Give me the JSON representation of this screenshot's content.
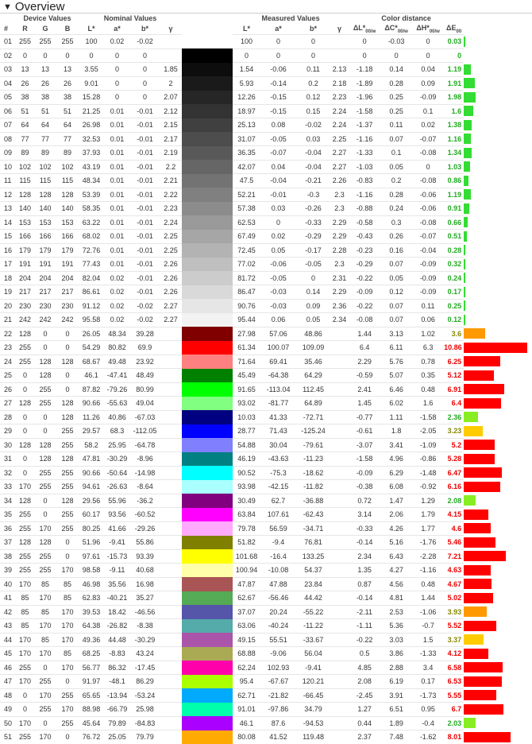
{
  "title": "Overview",
  "groups": {
    "device": "Device Values",
    "nominal": "Nominal Values",
    "measured": "Measured Values",
    "color_distance": "Color distance"
  },
  "headers": {
    "num": "#",
    "r": "R",
    "g": "G",
    "b": "B",
    "nl": "L*",
    "na": "a*",
    "nb": "b*",
    "ng": "γ",
    "ml": "L*",
    "ma": "a*",
    "mb": "b*",
    "mg": "γ",
    "dl": "ΔL*",
    "dc": "ΔC*",
    "dh": "ΔH*",
    "de": "ΔE",
    "sub_w": "00/w",
    "sub_00": "00"
  },
  "colors": {
    "good": "#33dd33",
    "ok": "#88ee22",
    "warn": "#ffcc00",
    "medium": "#ff9900",
    "bad": "#ff0000",
    "good_text": "#22aa22",
    "warn_text": "#888800",
    "bad_text": "#ee0000"
  },
  "rows": [
    {
      "n": "01",
      "r": "255",
      "g": "255",
      "b": "255",
      "nl": "100",
      "na": "0.02",
      "nb": "-0.02",
      "ng": "",
      "hex": "#ffffff",
      "ml": "100",
      "ma": "0",
      "mb": "0",
      "mg": "",
      "dl": "0",
      "dc": "-0.03",
      "dh": "0",
      "de": "0.03",
      "de_level": "good"
    },
    {
      "n": "02",
      "r": "0",
      "g": "0",
      "b": "0",
      "nl": "0",
      "na": "0",
      "nb": "0",
      "ng": "",
      "hex": "#000000",
      "ml": "0",
      "ma": "0",
      "mb": "0",
      "mg": "",
      "dl": "0",
      "dc": "0",
      "dh": "0",
      "de": "0",
      "de_level": "good"
    },
    {
      "n": "03",
      "r": "13",
      "g": "13",
      "b": "13",
      "nl": "3.55",
      "na": "0",
      "nb": "0",
      "ng": "1.85",
      "hex": "#0d0d0d",
      "ml": "1.54",
      "ma": "-0.06",
      "mb": "0.11",
      "mg": "2.13",
      "dl": "-1.18",
      "dc": "0.14",
      "dh": "0.04",
      "de": "1.19",
      "de_level": "good"
    },
    {
      "n": "04",
      "r": "26",
      "g": "26",
      "b": "26",
      "nl": "9.01",
      "na": "0",
      "nb": "0",
      "ng": "2",
      "hex": "#1a1a1a",
      "ml": "5.93",
      "ma": "-0.14",
      "mb": "0.2",
      "mg": "2.18",
      "dl": "-1.89",
      "dc": "0.28",
      "dh": "0.09",
      "de": "1.91",
      "de_level": "good"
    },
    {
      "n": "05",
      "r": "38",
      "g": "38",
      "b": "38",
      "nl": "15.28",
      "na": "0",
      "nb": "0",
      "ng": "2.07",
      "hex": "#262626",
      "ml": "12.26",
      "ma": "-0.15",
      "mb": "0.12",
      "mg": "2.23",
      "dl": "-1.96",
      "dc": "0.25",
      "dh": "-0.09",
      "de": "1.98",
      "de_level": "good"
    },
    {
      "n": "06",
      "r": "51",
      "g": "51",
      "b": "51",
      "nl": "21.25",
      "na": "0.01",
      "nb": "-0.01",
      "ng": "2.12",
      "hex": "#333333",
      "ml": "18.97",
      "ma": "-0.15",
      "mb": "0.15",
      "mg": "2.24",
      "dl": "-1.58",
      "dc": "0.25",
      "dh": "0.1",
      "de": "1.6",
      "de_level": "good"
    },
    {
      "n": "07",
      "r": "64",
      "g": "64",
      "b": "64",
      "nl": "26.98",
      "na": "0.01",
      "nb": "-0.01",
      "ng": "2.15",
      "hex": "#404040",
      "ml": "25.13",
      "ma": "0.08",
      "mb": "-0.02",
      "mg": "2.24",
      "dl": "-1.37",
      "dc": "0.11",
      "dh": "0.02",
      "de": "1.38",
      "de_level": "good"
    },
    {
      "n": "08",
      "r": "77",
      "g": "77",
      "b": "77",
      "nl": "32.53",
      "na": "0.01",
      "nb": "-0.01",
      "ng": "2.17",
      "hex": "#4d4d4d",
      "ml": "31.07",
      "ma": "-0.05",
      "mb": "0.03",
      "mg": "2.25",
      "dl": "-1.16",
      "dc": "0.07",
      "dh": "-0.07",
      "de": "1.16",
      "de_level": "good"
    },
    {
      "n": "09",
      "r": "89",
      "g": "89",
      "b": "89",
      "nl": "37.93",
      "na": "0.01",
      "nb": "-0.01",
      "ng": "2.19",
      "hex": "#595959",
      "ml": "36.35",
      "ma": "-0.07",
      "mb": "-0.04",
      "mg": "2.27",
      "dl": "-1.33",
      "dc": "0.1",
      "dh": "-0.08",
      "de": "1.34",
      "de_level": "good"
    },
    {
      "n": "10",
      "r": "102",
      "g": "102",
      "b": "102",
      "nl": "43.19",
      "na": "0.01",
      "nb": "-0.01",
      "ng": "2.2",
      "hex": "#666666",
      "ml": "42.07",
      "ma": "0.04",
      "mb": "-0.04",
      "mg": "2.27",
      "dl": "-1.03",
      "dc": "0.05",
      "dh": "0",
      "de": "1.03",
      "de_level": "good"
    },
    {
      "n": "11",
      "r": "115",
      "g": "115",
      "b": "115",
      "nl": "48.34",
      "na": "0.01",
      "nb": "-0.01",
      "ng": "2.21",
      "hex": "#737373",
      "ml": "47.5",
      "ma": "-0.04",
      "mb": "-0.21",
      "mg": "2.26",
      "dl": "-0.83",
      "dc": "0.2",
      "dh": "-0.08",
      "de": "0.86",
      "de_level": "good"
    },
    {
      "n": "12",
      "r": "128",
      "g": "128",
      "b": "128",
      "nl": "53.39",
      "na": "0.01",
      "nb": "-0.01",
      "ng": "2.22",
      "hex": "#808080",
      "ml": "52.21",
      "ma": "-0.01",
      "mb": "-0.3",
      "mg": "2.3",
      "dl": "-1.16",
      "dc": "0.28",
      "dh": "-0.06",
      "de": "1.19",
      "de_level": "good"
    },
    {
      "n": "13",
      "r": "140",
      "g": "140",
      "b": "140",
      "nl": "58.35",
      "na": "0.01",
      "nb": "-0.01",
      "ng": "2.23",
      "hex": "#8c8c8c",
      "ml": "57.38",
      "ma": "0.03",
      "mb": "-0.26",
      "mg": "2.3",
      "dl": "-0.88",
      "dc": "0.24",
      "dh": "-0.06",
      "de": "0.91",
      "de_level": "good"
    },
    {
      "n": "14",
      "r": "153",
      "g": "153",
      "b": "153",
      "nl": "63.22",
      "na": "0.01",
      "nb": "-0.01",
      "ng": "2.24",
      "hex": "#999999",
      "ml": "62.53",
      "ma": "0",
      "mb": "-0.33",
      "mg": "2.29",
      "dl": "-0.58",
      "dc": "0.3",
      "dh": "-0.08",
      "de": "0.66",
      "de_level": "good"
    },
    {
      "n": "15",
      "r": "166",
      "g": "166",
      "b": "166",
      "nl": "68.02",
      "na": "0.01",
      "nb": "-0.01",
      "ng": "2.25",
      "hex": "#a6a6a6",
      "ml": "67.49",
      "ma": "0.02",
      "mb": "-0.29",
      "mg": "2.29",
      "dl": "-0.43",
      "dc": "0.26",
      "dh": "-0.07",
      "de": "0.51",
      "de_level": "good"
    },
    {
      "n": "16",
      "r": "179",
      "g": "179",
      "b": "179",
      "nl": "72.76",
      "na": "0.01",
      "nb": "-0.01",
      "ng": "2.25",
      "hex": "#b3b3b3",
      "ml": "72.45",
      "ma": "0.05",
      "mb": "-0.17",
      "mg": "2.28",
      "dl": "-0.23",
      "dc": "0.16",
      "dh": "-0.04",
      "de": "0.28",
      "de_level": "good"
    },
    {
      "n": "17",
      "r": "191",
      "g": "191",
      "b": "191",
      "nl": "77.43",
      "na": "0.01",
      "nb": "-0.01",
      "ng": "2.26",
      "hex": "#bfbfbf",
      "ml": "77.02",
      "ma": "-0.06",
      "mb": "-0.05",
      "mg": "2.3",
      "dl": "-0.29",
      "dc": "0.07",
      "dh": "-0.09",
      "de": "0.32",
      "de_level": "good"
    },
    {
      "n": "18",
      "r": "204",
      "g": "204",
      "b": "204",
      "nl": "82.04",
      "na": "0.02",
      "nb": "-0.01",
      "ng": "2.26",
      "hex": "#cccccc",
      "ml": "81.72",
      "ma": "-0.05",
      "mb": "0",
      "mg": "2.31",
      "dl": "-0.22",
      "dc": "0.05",
      "dh": "-0.09",
      "de": "0.24",
      "de_level": "good"
    },
    {
      "n": "19",
      "r": "217",
      "g": "217",
      "b": "217",
      "nl": "86.61",
      "na": "0.02",
      "nb": "-0.01",
      "ng": "2.26",
      "hex": "#d9d9d9",
      "ml": "86.47",
      "ma": "-0.03",
      "mb": "0.14",
      "mg": "2.29",
      "dl": "-0.09",
      "dc": "0.12",
      "dh": "-0.09",
      "de": "0.17",
      "de_level": "good"
    },
    {
      "n": "20",
      "r": "230",
      "g": "230",
      "b": "230",
      "nl": "91.12",
      "na": "0.02",
      "nb": "-0.02",
      "ng": "2.27",
      "hex": "#e6e6e6",
      "ml": "90.76",
      "ma": "-0.03",
      "mb": "0.09",
      "mg": "2.36",
      "dl": "-0.22",
      "dc": "0.07",
      "dh": "0.11",
      "de": "0.25",
      "de_level": "good"
    },
    {
      "n": "21",
      "r": "242",
      "g": "242",
      "b": "242",
      "nl": "95.58",
      "na": "0.02",
      "nb": "-0.02",
      "ng": "2.27",
      "hex": "#f2f2f2",
      "ml": "95.44",
      "ma": "0.06",
      "mb": "0.05",
      "mg": "2.34",
      "dl": "-0.08",
      "dc": "0.07",
      "dh": "0.06",
      "de": "0.12",
      "de_level": "good"
    },
    {
      "n": "22",
      "r": "128",
      "g": "0",
      "b": "0",
      "nl": "26.05",
      "na": "48.34",
      "nb": "39.28",
      "ng": "",
      "hex": "#800000",
      "ml": "27.98",
      "ma": "57.06",
      "mb": "48.86",
      "mg": "",
      "dl": "1.44",
      "dc": "3.13",
      "dh": "1.02",
      "de": "3.6",
      "de_level": "medium"
    },
    {
      "n": "23",
      "r": "255",
      "g": "0",
      "b": "0",
      "nl": "54.29",
      "na": "80.82",
      "nb": "69.9",
      "ng": "",
      "hex": "#ff0000",
      "ml": "61.34",
      "ma": "100.07",
      "mb": "109.09",
      "mg": "",
      "dl": "6.4",
      "dc": "6.11",
      "dh": "6.3",
      "de": "10.86",
      "de_level": "bad"
    },
    {
      "n": "24",
      "r": "255",
      "g": "128",
      "b": "128",
      "nl": "68.67",
      "na": "49.48",
      "nb": "23.92",
      "ng": "",
      "hex": "#ff8080",
      "ml": "71.64",
      "ma": "69.41",
      "mb": "35.46",
      "mg": "",
      "dl": "2.29",
      "dc": "5.76",
      "dh": "0.78",
      "de": "6.25",
      "de_level": "bad"
    },
    {
      "n": "25",
      "r": "0",
      "g": "128",
      "b": "0",
      "nl": "46.1",
      "na": "-47.41",
      "nb": "48.49",
      "ng": "",
      "hex": "#008000",
      "ml": "45.49",
      "ma": "-64.38",
      "mb": "64.29",
      "mg": "",
      "dl": "-0.59",
      "dc": "5.07",
      "dh": "0.35",
      "de": "5.12",
      "de_level": "bad"
    },
    {
      "n": "26",
      "r": "0",
      "g": "255",
      "b": "0",
      "nl": "87.82",
      "na": "-79.26",
      "nb": "80.99",
      "ng": "",
      "hex": "#00ff00",
      "ml": "91.65",
      "ma": "-113.04",
      "mb": "112.45",
      "mg": "",
      "dl": "2.41",
      "dc": "6.46",
      "dh": "0.48",
      "de": "6.91",
      "de_level": "bad"
    },
    {
      "n": "27",
      "r": "128",
      "g": "255",
      "b": "128",
      "nl": "90.66",
      "na": "-55.63",
      "nb": "49.04",
      "ng": "",
      "hex": "#80ff80",
      "ml": "93.02",
      "ma": "-81.77",
      "mb": "64.89",
      "mg": "",
      "dl": "1.45",
      "dc": "6.02",
      "dh": "1.6",
      "de": "6.4",
      "de_level": "bad"
    },
    {
      "n": "28",
      "r": "0",
      "g": "0",
      "b": "128",
      "nl": "11.26",
      "na": "40.86",
      "nb": "-67.03",
      "ng": "",
      "hex": "#000080",
      "ml": "10.03",
      "ma": "41.33",
      "mb": "-72.71",
      "mg": "",
      "dl": "-0.77",
      "dc": "1.11",
      "dh": "-1.58",
      "de": "2.36",
      "de_level": "ok"
    },
    {
      "n": "29",
      "r": "0",
      "g": "0",
      "b": "255",
      "nl": "29.57",
      "na": "68.3",
      "nb": "-112.05",
      "ng": "",
      "hex": "#0000ff",
      "ml": "28.77",
      "ma": "71.43",
      "mb": "-125.24",
      "mg": "",
      "dl": "-0.61",
      "dc": "1.8",
      "dh": "-2.05",
      "de": "3.23",
      "de_level": "warn"
    },
    {
      "n": "30",
      "r": "128",
      "g": "128",
      "b": "255",
      "nl": "58.2",
      "na": "25.95",
      "nb": "-64.78",
      "ng": "",
      "hex": "#8080ff",
      "ml": "54.88",
      "ma": "30.04",
      "mb": "-79.61",
      "mg": "",
      "dl": "-3.07",
      "dc": "3.41",
      "dh": "-1.09",
      "de": "5.2",
      "de_level": "bad"
    },
    {
      "n": "31",
      "r": "0",
      "g": "128",
      "b": "128",
      "nl": "47.81",
      "na": "-30.29",
      "nb": "-8.96",
      "ng": "",
      "hex": "#008080",
      "ml": "46.19",
      "ma": "-43.63",
      "mb": "-11.23",
      "mg": "",
      "dl": "-1.58",
      "dc": "4.96",
      "dh": "-0.86",
      "de": "5.28",
      "de_level": "bad"
    },
    {
      "n": "32",
      "r": "0",
      "g": "255",
      "b": "255",
      "nl": "90.66",
      "na": "-50.64",
      "nb": "-14.98",
      "ng": "",
      "hex": "#00ffff",
      "ml": "90.52",
      "ma": "-75.3",
      "mb": "-18.62",
      "mg": "",
      "dl": "-0.09",
      "dc": "6.29",
      "dh": "-1.48",
      "de": "6.47",
      "de_level": "bad"
    },
    {
      "n": "33",
      "r": "170",
      "g": "255",
      "b": "255",
      "nl": "94.61",
      "na": "-26.63",
      "nb": "-8.64",
      "ng": "",
      "hex": "#aaffff",
      "ml": "93.98",
      "ma": "-42.15",
      "mb": "-11.82",
      "mg": "",
      "dl": "-0.38",
      "dc": "6.08",
      "dh": "-0.92",
      "de": "6.16",
      "de_level": "bad"
    },
    {
      "n": "34",
      "r": "128",
      "g": "0",
      "b": "128",
      "nl": "29.56",
      "na": "55.96",
      "nb": "-36.2",
      "ng": "",
      "hex": "#800080",
      "ml": "30.49",
      "ma": "62.7",
      "mb": "-36.88",
      "mg": "",
      "dl": "0.72",
      "dc": "1.47",
      "dh": "1.29",
      "de": "2.08",
      "de_level": "ok"
    },
    {
      "n": "35",
      "r": "255",
      "g": "0",
      "b": "255",
      "nl": "60.17",
      "na": "93.56",
      "nb": "-60.52",
      "ng": "",
      "hex": "#ff00ff",
      "ml": "63.84",
      "ma": "107.61",
      "mb": "-62.43",
      "mg": "",
      "dl": "3.14",
      "dc": "2.06",
      "dh": "1.79",
      "de": "4.15",
      "de_level": "bad"
    },
    {
      "n": "36",
      "r": "255",
      "g": "170",
      "b": "255",
      "nl": "80.25",
      "na": "41.66",
      "nb": "-29.26",
      "ng": "",
      "hex": "#ffaaff",
      "ml": "79.78",
      "ma": "56.59",
      "mb": "-34.71",
      "mg": "",
      "dl": "-0.33",
      "dc": "4.26",
      "dh": "1.77",
      "de": "4.6",
      "de_level": "bad"
    },
    {
      "n": "37",
      "r": "128",
      "g": "128",
      "b": "0",
      "nl": "51.96",
      "na": "-9.41",
      "nb": "55.86",
      "ng": "",
      "hex": "#808000",
      "ml": "51.82",
      "ma": "-9.4",
      "mb": "76.81",
      "mg": "",
      "dl": "-0.14",
      "dc": "5.16",
      "dh": "-1.76",
      "de": "5.46",
      "de_level": "bad"
    },
    {
      "n": "38",
      "r": "255",
      "g": "255",
      "b": "0",
      "nl": "97.61",
      "na": "-15.73",
      "nb": "93.39",
      "ng": "",
      "hex": "#ffff00",
      "ml": "101.68",
      "ma": "-16.4",
      "mb": "133.25",
      "mg": "",
      "dl": "2.34",
      "dc": "6.43",
      "dh": "-2.28",
      "de": "7.21",
      "de_level": "bad"
    },
    {
      "n": "39",
      "r": "255",
      "g": "255",
      "b": "170",
      "nl": "98.58",
      "na": "-9.11",
      "nb": "40.68",
      "ng": "",
      "hex": "#ffffaa",
      "ml": "100.94",
      "ma": "-10.08",
      "mb": "54.37",
      "mg": "",
      "dl": "1.35",
      "dc": "4.27",
      "dh": "-1.16",
      "de": "4.63",
      "de_level": "bad"
    },
    {
      "n": "40",
      "r": "170",
      "g": "85",
      "b": "85",
      "nl": "46.98",
      "na": "35.56",
      "nb": "16.98",
      "ng": "",
      "hex": "#aa5555",
      "ml": "47.87",
      "ma": "47.88",
      "mb": "23.84",
      "mg": "",
      "dl": "0.87",
      "dc": "4.56",
      "dh": "0.48",
      "de": "4.67",
      "de_level": "bad"
    },
    {
      "n": "41",
      "r": "85",
      "g": "170",
      "b": "85",
      "nl": "62.83",
      "na": "-40.21",
      "nb": "35.27",
      "ng": "",
      "hex": "#55aa55",
      "ml": "62.67",
      "ma": "-56.46",
      "mb": "44.42",
      "mg": "",
      "dl": "-0.14",
      "dc": "4.81",
      "dh": "1.44",
      "de": "5.02",
      "de_level": "bad"
    },
    {
      "n": "42",
      "r": "85",
      "g": "85",
      "b": "170",
      "nl": "39.53",
      "na": "18.42",
      "nb": "-46.56",
      "ng": "",
      "hex": "#5555aa",
      "ml": "37.07",
      "ma": "20.24",
      "mb": "-55.22",
      "mg": "",
      "dl": "-2.11",
      "dc": "2.53",
      "dh": "-1.06",
      "de": "3.93",
      "de_level": "medium"
    },
    {
      "n": "43",
      "r": "85",
      "g": "170",
      "b": "170",
      "nl": "64.38",
      "na": "-26.82",
      "nb": "-8.38",
      "ng": "",
      "hex": "#55aaaa",
      "ml": "63.06",
      "ma": "-40.24",
      "mb": "-11.22",
      "mg": "",
      "dl": "-1.11",
      "dc": "5.36",
      "dh": "-0.7",
      "de": "5.52",
      "de_level": "bad"
    },
    {
      "n": "44",
      "r": "170",
      "g": "85",
      "b": "170",
      "nl": "49.36",
      "na": "44.48",
      "nb": "-30.29",
      "ng": "",
      "hex": "#aa55aa",
      "ml": "49.15",
      "ma": "55.51",
      "mb": "-33.67",
      "mg": "",
      "dl": "-0.22",
      "dc": "3.03",
      "dh": "1.5",
      "de": "3.37",
      "de_level": "warn"
    },
    {
      "n": "45",
      "r": "170",
      "g": "170",
      "b": "85",
      "nl": "68.25",
      "na": "-8.83",
      "nb": "43.24",
      "ng": "",
      "hex": "#aaaa55",
      "ml": "68.88",
      "ma": "-9.06",
      "mb": "56.04",
      "mg": "",
      "dl": "0.5",
      "dc": "3.86",
      "dh": "-1.33",
      "de": "4.12",
      "de_level": "bad"
    },
    {
      "n": "46",
      "r": "255",
      "g": "0",
      "b": "170",
      "nl": "56.77",
      "na": "86.32",
      "nb": "-17.45",
      "ng": "",
      "hex": "#ff00aa",
      "ml": "62.24",
      "ma": "102.93",
      "mb": "-9.41",
      "mg": "",
      "dl": "4.85",
      "dc": "2.88",
      "dh": "3.4",
      "de": "6.58",
      "de_level": "bad"
    },
    {
      "n": "47",
      "r": "170",
      "g": "255",
      "b": "0",
      "nl": "91.97",
      "na": "-48.1",
      "nb": "86.29",
      "ng": "",
      "hex": "#aaff00",
      "ml": "95.4",
      "ma": "-67.67",
      "mb": "120.21",
      "mg": "",
      "dl": "2.08",
      "dc": "6.19",
      "dh": "0.17",
      "de": "6.53",
      "de_level": "bad"
    },
    {
      "n": "48",
      "r": "0",
      "g": "170",
      "b": "255",
      "nl": "65.65",
      "na": "-13.94",
      "nb": "-53.24",
      "ng": "",
      "hex": "#00aaff",
      "ml": "62.71",
      "ma": "-21.82",
      "mb": "-66.45",
      "mg": "",
      "dl": "-2.45",
      "dc": "3.91",
      "dh": "-1.73",
      "de": "5.55",
      "de_level": "bad"
    },
    {
      "n": "49",
      "r": "0",
      "g": "255",
      "b": "170",
      "nl": "88.98",
      "na": "-66.79",
      "nb": "25.98",
      "ng": "",
      "hex": "#00ffaa",
      "ml": "91.01",
      "ma": "-97.86",
      "mb": "34.79",
      "mg": "",
      "dl": "1.27",
      "dc": "6.51",
      "dh": "0.95",
      "de": "6.7",
      "de_level": "bad"
    },
    {
      "n": "50",
      "r": "170",
      "g": "0",
      "b": "255",
      "nl": "45.64",
      "na": "79.89",
      "nb": "-84.83",
      "ng": "",
      "hex": "#aa00ff",
      "ml": "46.1",
      "ma": "87.6",
      "mb": "-94.53",
      "mg": "",
      "dl": "0.44",
      "dc": "1.89",
      "dh": "-0.4",
      "de": "2.03",
      "de_level": "ok"
    },
    {
      "n": "51",
      "r": "255",
      "g": "170",
      "b": "0",
      "nl": "76.72",
      "na": "25.05",
      "nb": "79.79",
      "ng": "",
      "hex": "#ffaa00",
      "ml": "80.08",
      "ma": "41.52",
      "mb": "119.48",
      "mg": "",
      "dl": "2.37",
      "dc": "7.48",
      "dh": "-1.62",
      "de": "8.01",
      "de_level": "bad"
    }
  ]
}
